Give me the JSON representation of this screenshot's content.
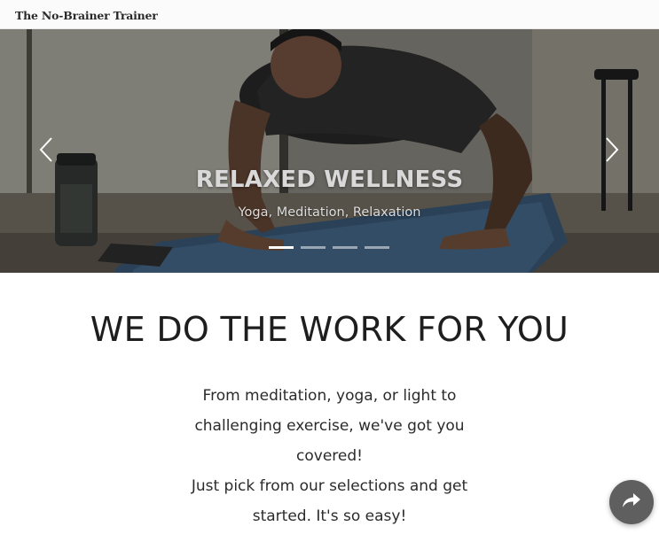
{
  "navbar": {
    "brand": "The No-Brainer Trainer"
  },
  "carousel": {
    "active_index": 0,
    "slides": [
      {
        "title": "RELAXED WELLNESS",
        "subtitle": "Yoga, Meditation, Relaxation"
      }
    ],
    "indicator_count": 4,
    "prev_icon": "chevron-left-icon",
    "next_icon": "chevron-right-icon"
  },
  "main": {
    "headline": "WE DO THE WORK FOR YOU",
    "intro_lines": [
      "From meditation, yoga, or light to challenging exercise, we've got you covered!",
      "Just pick from our selections and get started. It's so easy!"
    ]
  },
  "fab": {
    "icon": "share-arrow-icon"
  },
  "colors": {
    "navbar_bg": "#fbfbfb",
    "headline": "#1e1e1e",
    "fab_bg": "#5f5f5f"
  }
}
